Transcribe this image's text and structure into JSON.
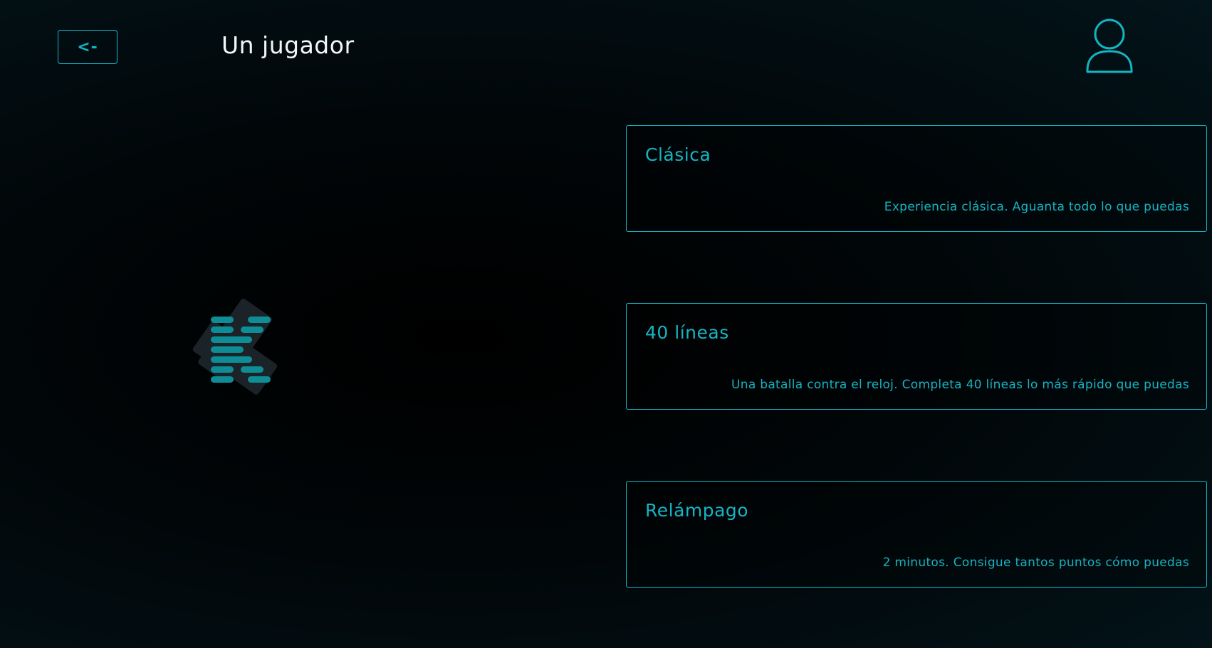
{
  "header": {
    "back_label": "<-",
    "title": "Un jugador",
    "user_icon": "user-icon"
  },
  "logo": {
    "icon": "tetris-logo-icon"
  },
  "modes": [
    {
      "title": "Clásica",
      "description": "Experiencia clásica. Aguanta todo lo que puedas"
    },
    {
      "title": "40 líneas",
      "description": "Una batalla contra el reloj. Completa 40 líneas lo más rápido que puedas"
    },
    {
      "title": "Relámpago",
      "description": "2 minutos. Consigue tantos puntos cómo puedas"
    }
  ],
  "colors": {
    "accent": "#12b5c4",
    "background": "#010608",
    "title_text": "#f2f6f7"
  }
}
